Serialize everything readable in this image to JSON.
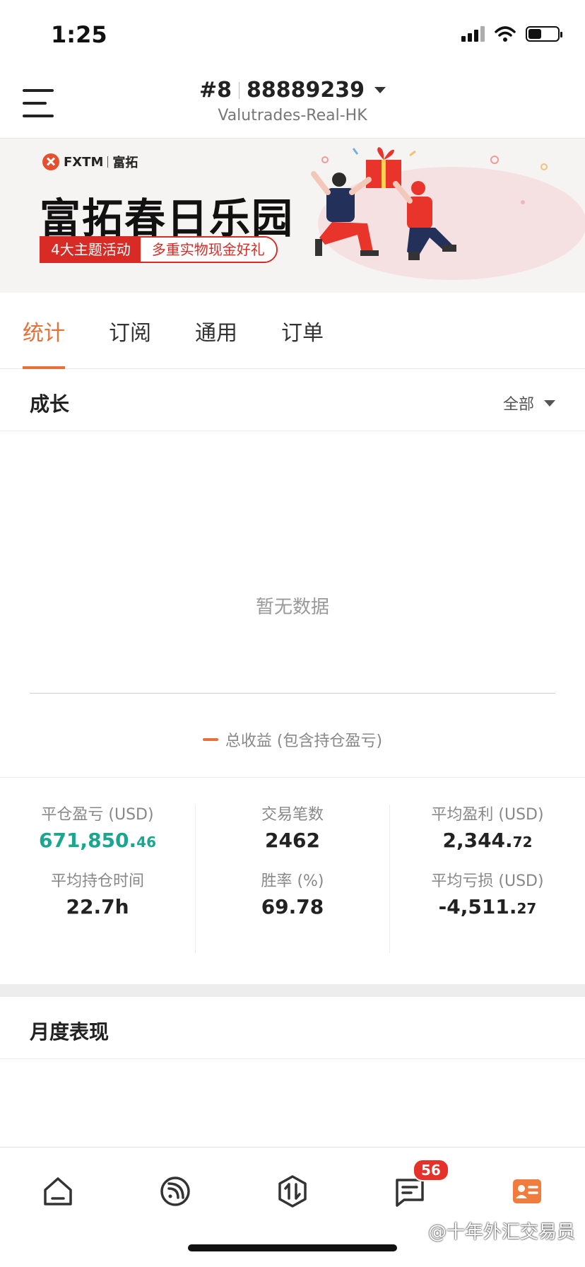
{
  "status_bar": {
    "time": "1:25"
  },
  "header": {
    "account_no": "#8",
    "account_id": "88889239",
    "server": "Valutrades-Real-HK"
  },
  "banner": {
    "logo_text": "FXTM",
    "logo_cn": "富拓",
    "title": "富拓春日乐园",
    "tag_left": "4大主题活动",
    "tag_right": "多重实物现金好礼"
  },
  "tabs": [
    {
      "label": "统计",
      "active": true
    },
    {
      "label": "订阅",
      "active": false
    },
    {
      "label": "通用",
      "active": false
    },
    {
      "label": "订单",
      "active": false
    }
  ],
  "growth": {
    "title": "成长",
    "filter": "全部",
    "empty_text": "暂无数据",
    "legend": "总收益 (包含持仓盈亏)",
    "legend_color": "#e8703a"
  },
  "stats": [
    [
      {
        "label": "平仓盈亏 (USD)",
        "value_main": "671,850.",
        "value_dec": "46",
        "color": "#1aa68f"
      },
      {
        "label": "平均持仓时间",
        "value_main": "22.7h",
        "value_dec": ""
      }
    ],
    [
      {
        "label": "交易笔数",
        "value_main": "2462",
        "value_dec": ""
      },
      {
        "label": "胜率 (%)",
        "value_main": "69.78",
        "value_dec": ""
      }
    ],
    [
      {
        "label": "平均盈利 (USD)",
        "value_main": "2,344.",
        "value_dec": "72"
      },
      {
        "label": "平均亏损 (USD)",
        "value_main": "-4,511.",
        "value_dec": "27"
      }
    ]
  ],
  "monthly": {
    "title": "月度表现"
  },
  "bottom_nav": {
    "items": [
      "home-icon",
      "feed-icon",
      "trade-icon",
      "message-icon",
      "profile-icon"
    ],
    "message_badge": "56",
    "active_color": "#f07d3e"
  },
  "watermark": "@十年外汇交易员"
}
